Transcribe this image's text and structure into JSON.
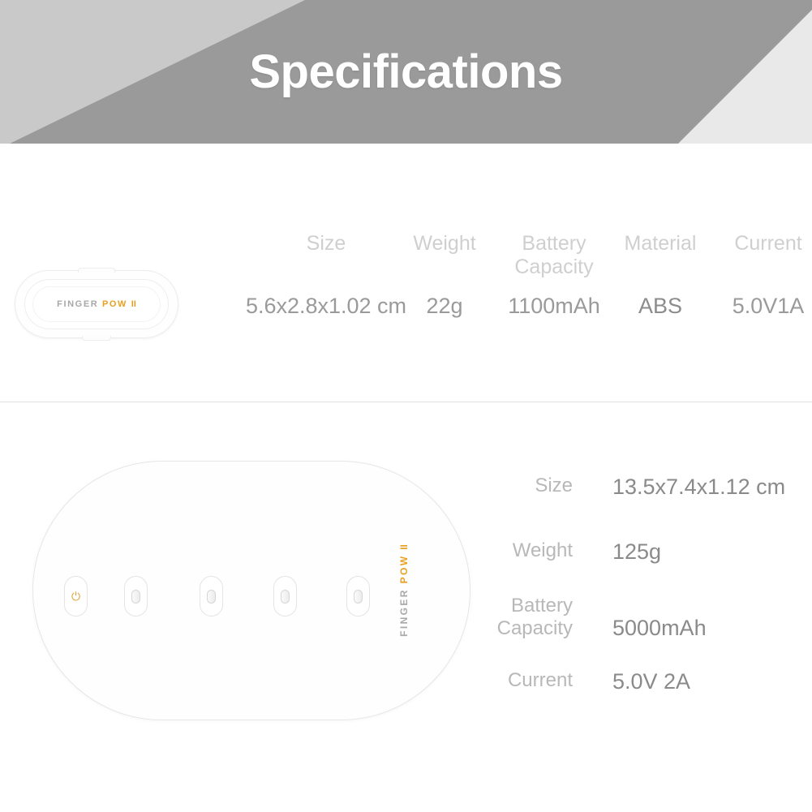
{
  "banner": {
    "title": "Specifications",
    "bg_light": "#c9c9c9",
    "bg_dark": "#9a9a9a",
    "bg_right": "#e9e9e9",
    "title_color": "#ffffff"
  },
  "brand": {
    "name_part1": "FINGER",
    "name_part2": "POW",
    "name_part3": "II",
    "color_primary": "#a8a8a8",
    "color_accent": "#e8a020"
  },
  "product_small": {
    "device_name": "Finger Pow II battery",
    "columns": [
      {
        "label": "Size",
        "value": "5.6x2.8x1.02 cm"
      },
      {
        "label": "Weight",
        "value": "22g"
      },
      {
        "label": "Battery\nCapacity",
        "value": "1100mAh"
      },
      {
        "label": "Material",
        "value": "ABS"
      },
      {
        "label": "Current",
        "value": "5.0V1A"
      }
    ]
  },
  "product_dock": {
    "device_name": "Finger Pow II charging dock",
    "slot_count": 5,
    "power_icon": "power-icon",
    "power_icon_glyph": "⏻",
    "rows": [
      {
        "label": "Size",
        "value": "13.5x7.4x1.12 cm"
      },
      {
        "label": "Weight",
        "value": "125g"
      },
      {
        "label": "Battery\nCapacity",
        "value": "5000mAh"
      },
      {
        "label": "Current",
        "value": "5.0V 2A"
      }
    ]
  }
}
